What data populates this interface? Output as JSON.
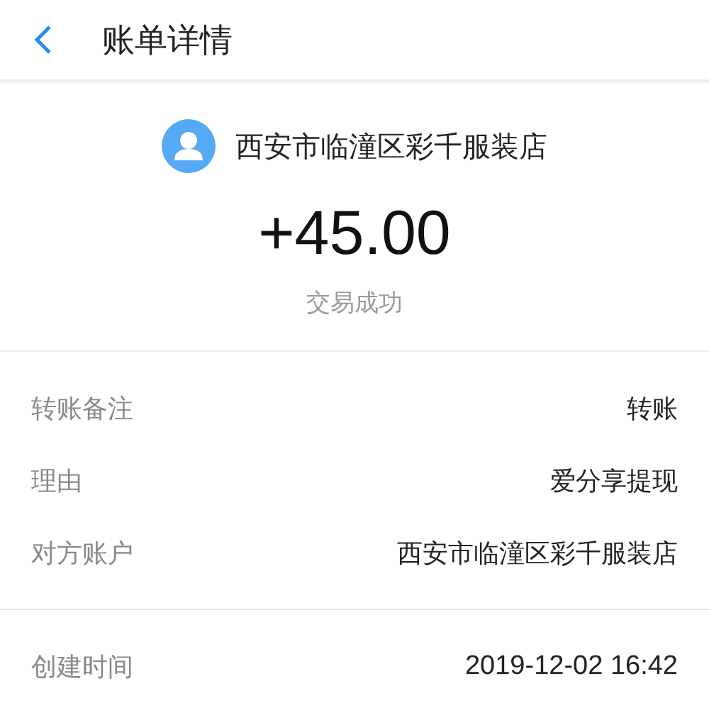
{
  "header": {
    "title": "账单详情"
  },
  "merchant": {
    "name": "西安市临潼区彩千服装店"
  },
  "amount": "+45.00",
  "status": "交易成功",
  "details": [
    {
      "label": "转账备注",
      "value": "转账"
    },
    {
      "label": "理由",
      "value": "爱分享提现"
    },
    {
      "label": "对方账户",
      "value": "西安市临潼区彩千服装店"
    }
  ],
  "times": [
    {
      "label": "创建时间",
      "value": "2019-12-02 16:42"
    }
  ]
}
